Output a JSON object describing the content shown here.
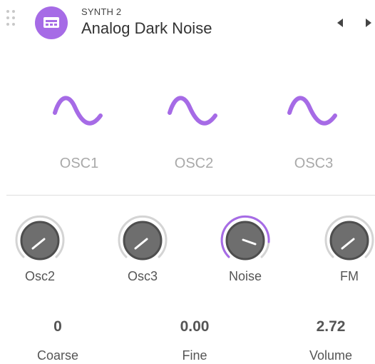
{
  "header": {
    "kicker": "SYNTH 2",
    "title": "Analog Dark Noise",
    "icon": "synth-device-icon"
  },
  "colors": {
    "accent": "#a66be6",
    "knob_body": "#6e6e6e",
    "ring_inactive": "#d4d4d4",
    "label_muted": "#a9a9a9",
    "text": "#555555"
  },
  "oscillators": [
    {
      "label": "OSC1",
      "waveform": "sine"
    },
    {
      "label": "OSC2",
      "waveform": "sine"
    },
    {
      "label": "OSC3",
      "waveform": "sine"
    }
  ],
  "knobs": [
    {
      "label": "Osc2",
      "active": false
    },
    {
      "label": "Osc3",
      "active": false
    },
    {
      "label": "Noise",
      "active": true
    },
    {
      "label": "FM",
      "active": false
    }
  ],
  "params": [
    {
      "label": "Coarse",
      "value": "0"
    },
    {
      "label": "Fine",
      "value": "0.00"
    },
    {
      "label": "Volume",
      "value": "2.72"
    }
  ]
}
